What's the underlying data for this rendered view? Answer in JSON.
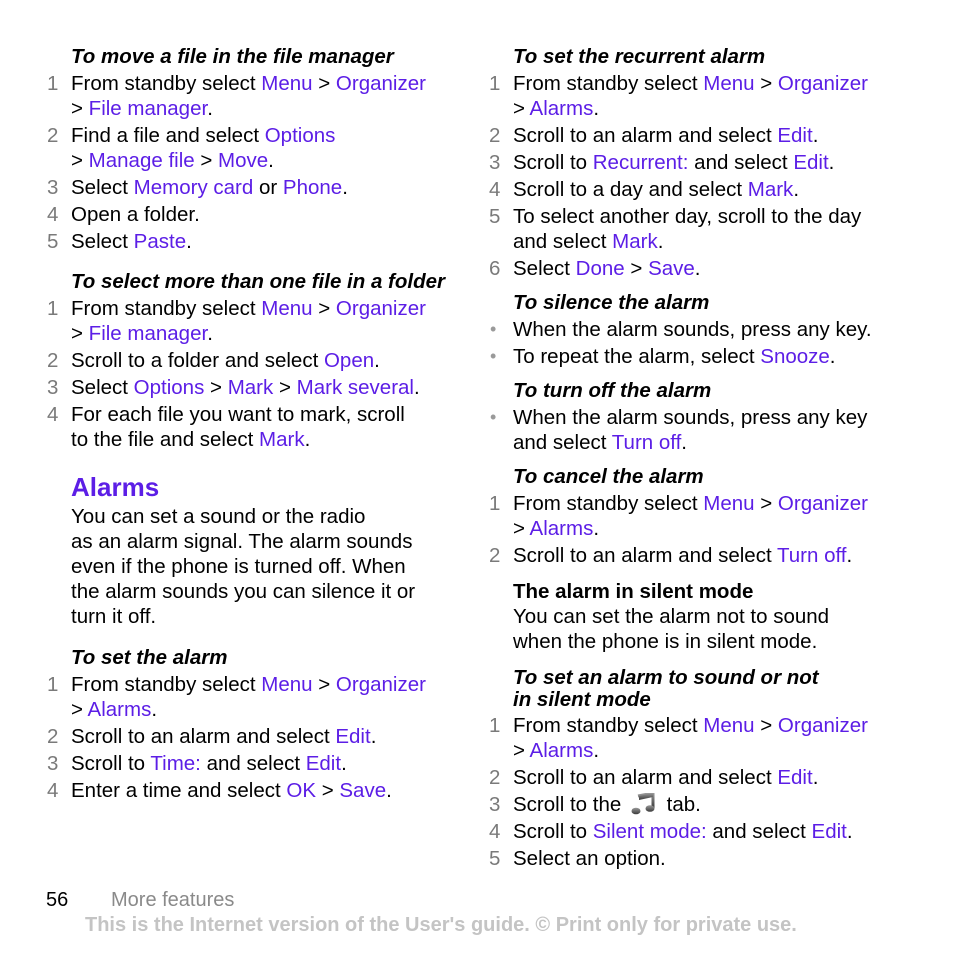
{
  "left": {
    "move_file": {
      "heading": "To move a file in the file manager",
      "steps": [
        {
          "n": "1",
          "parts": [
            {
              "t": "From standby select "
            },
            {
              "l": "Menu"
            },
            {
              "t": " > "
            },
            {
              "l": "Organizer"
            },
            {
              "br": true
            },
            {
              "t": "> "
            },
            {
              "l": "File manager"
            },
            {
              "t": "."
            }
          ]
        },
        {
          "n": "2",
          "parts": [
            {
              "t": "Find a file and select "
            },
            {
              "l": "Options"
            },
            {
              "br": true
            },
            {
              "t": "> "
            },
            {
              "l": "Manage file"
            },
            {
              "t": " > "
            },
            {
              "l": "Move"
            },
            {
              "t": "."
            }
          ]
        },
        {
          "n": "3",
          "parts": [
            {
              "t": "Select "
            },
            {
              "l": "Memory card"
            },
            {
              "t": " or "
            },
            {
              "l": "Phone"
            },
            {
              "t": "."
            }
          ]
        },
        {
          "n": "4",
          "parts": [
            {
              "t": "Open a folder."
            }
          ]
        },
        {
          "n": "5",
          "parts": [
            {
              "t": "Select "
            },
            {
              "l": "Paste"
            },
            {
              "t": "."
            }
          ]
        }
      ]
    },
    "select_more": {
      "heading": "To select more than one file in a folder",
      "steps": [
        {
          "n": "1",
          "parts": [
            {
              "t": "From standby select "
            },
            {
              "l": "Menu"
            },
            {
              "t": " > "
            },
            {
              "l": "Organizer"
            },
            {
              "br": true
            },
            {
              "t": "> "
            },
            {
              "l": "File manager"
            },
            {
              "t": "."
            }
          ]
        },
        {
          "n": "2",
          "parts": [
            {
              "t": "Scroll to a folder and select "
            },
            {
              "l": "Open"
            },
            {
              "t": "."
            }
          ]
        },
        {
          "n": "3",
          "parts": [
            {
              "t": "Select "
            },
            {
              "l": "Options"
            },
            {
              "t": " > "
            },
            {
              "l": "Mark"
            },
            {
              "t": " > "
            },
            {
              "l": "Mark several"
            },
            {
              "t": "."
            }
          ]
        },
        {
          "n": "4",
          "parts": [
            {
              "t": "For each file you want to mark, scroll"
            },
            {
              "br": true
            },
            {
              "t": "to the file and select "
            },
            {
              "l": "Mark"
            },
            {
              "t": "."
            }
          ]
        }
      ]
    },
    "alarms_title": "Alarms",
    "alarms_intro_lines": [
      "You can set a sound or the radio",
      "as an alarm signal. The alarm sounds",
      "even if the phone is turned off. When",
      "the alarm sounds you can silence it or",
      "turn it off."
    ],
    "set_alarm": {
      "heading": "To set the alarm",
      "steps": [
        {
          "n": "1",
          "parts": [
            {
              "t": "From standby select "
            },
            {
              "l": "Menu"
            },
            {
              "t": " > "
            },
            {
              "l": "Organizer"
            },
            {
              "br": true
            },
            {
              "t": "> "
            },
            {
              "l": "Alarms"
            },
            {
              "t": "."
            }
          ]
        },
        {
          "n": "2",
          "parts": [
            {
              "t": "Scroll to an alarm and select "
            },
            {
              "l": "Edit"
            },
            {
              "t": "."
            }
          ]
        },
        {
          "n": "3",
          "parts": [
            {
              "t": "Scroll to "
            },
            {
              "l": "Time:"
            },
            {
              "t": " and select "
            },
            {
              "l": "Edit"
            },
            {
              "t": "."
            }
          ]
        },
        {
          "n": "4",
          "parts": [
            {
              "t": "Enter a time and select "
            },
            {
              "l": "OK"
            },
            {
              "t": " > "
            },
            {
              "l": "Save"
            },
            {
              "t": "."
            }
          ]
        }
      ]
    }
  },
  "right": {
    "recurrent": {
      "heading": "To set the recurrent alarm",
      "steps": [
        {
          "n": "1",
          "parts": [
            {
              "t": "From standby select "
            },
            {
              "l": "Menu"
            },
            {
              "t": " > "
            },
            {
              "l": "Organizer"
            },
            {
              "br": true
            },
            {
              "t": "> "
            },
            {
              "l": "Alarms"
            },
            {
              "t": "."
            }
          ]
        },
        {
          "n": "2",
          "parts": [
            {
              "t": "Scroll to an alarm and select "
            },
            {
              "l": "Edit"
            },
            {
              "t": "."
            }
          ]
        },
        {
          "n": "3",
          "parts": [
            {
              "t": "Scroll to "
            },
            {
              "l": "Recurrent:"
            },
            {
              "t": " and select "
            },
            {
              "l": "Edit"
            },
            {
              "t": "."
            }
          ]
        },
        {
          "n": "4",
          "parts": [
            {
              "t": "Scroll to a day and select "
            },
            {
              "l": "Mark"
            },
            {
              "t": "."
            }
          ]
        },
        {
          "n": "5",
          "parts": [
            {
              "t": "To select another day, scroll to the day"
            },
            {
              "br": true
            },
            {
              "t": "and select "
            },
            {
              "l": "Mark"
            },
            {
              "t": "."
            }
          ]
        },
        {
          "n": "6",
          "parts": [
            {
              "t": "Select "
            },
            {
              "l": "Done"
            },
            {
              "t": " > "
            },
            {
              "l": "Save"
            },
            {
              "t": "."
            }
          ]
        }
      ]
    },
    "silence": {
      "heading": "To silence the alarm",
      "bullets": [
        {
          "parts": [
            {
              "t": "When the alarm sounds, press any key."
            }
          ]
        },
        {
          "parts": [
            {
              "t": "To repeat the alarm, select "
            },
            {
              "l": "Snooze"
            },
            {
              "t": "."
            }
          ]
        }
      ]
    },
    "turn_off": {
      "heading": "To turn off the alarm",
      "bullets": [
        {
          "parts": [
            {
              "t": "When the alarm sounds, press any key"
            },
            {
              "br": true
            },
            {
              "t": "and select "
            },
            {
              "l": "Turn off"
            },
            {
              "t": "."
            }
          ]
        }
      ]
    },
    "cancel": {
      "heading": "To cancel the alarm",
      "steps": [
        {
          "n": "1",
          "parts": [
            {
              "t": "From standby select "
            },
            {
              "l": "Menu"
            },
            {
              "t": " > "
            },
            {
              "l": "Organizer"
            },
            {
              "br": true
            },
            {
              "t": "> "
            },
            {
              "l": "Alarms"
            },
            {
              "t": "."
            }
          ]
        },
        {
          "n": "2",
          "parts": [
            {
              "t": "Scroll to an alarm and select "
            },
            {
              "l": "Turn off"
            },
            {
              "t": "."
            }
          ]
        }
      ]
    },
    "silent_mode_subhead": "The alarm in silent mode",
    "silent_mode_lines": [
      "You can set the alarm not to sound",
      "when the phone is in silent mode."
    ],
    "silent_set": {
      "heading_lines": [
        "To set an alarm to sound or not",
        "in silent mode"
      ],
      "steps": [
        {
          "n": "1",
          "parts": [
            {
              "t": "From standby select "
            },
            {
              "l": "Menu"
            },
            {
              "t": " > "
            },
            {
              "l": "Organizer"
            },
            {
              "br": true
            },
            {
              "t": "> "
            },
            {
              "l": "Alarms"
            },
            {
              "t": "."
            }
          ]
        },
        {
          "n": "2",
          "parts": [
            {
              "t": "Scroll to an alarm and select "
            },
            {
              "l": "Edit"
            },
            {
              "t": "."
            }
          ]
        },
        {
          "n": "3",
          "parts": [
            {
              "t": "Scroll to the "
            },
            {
              "icon": "music-note-icon"
            },
            {
              "t": " tab."
            }
          ]
        },
        {
          "n": "4",
          "parts": [
            {
              "t": "Scroll to "
            },
            {
              "l": "Silent mode:"
            },
            {
              "t": " and select "
            },
            {
              "l": "Edit"
            },
            {
              "t": "."
            }
          ]
        },
        {
          "n": "5",
          "parts": [
            {
              "t": "Select an option."
            }
          ]
        }
      ]
    }
  },
  "footer": {
    "page_number": "56",
    "section": "More features",
    "notice": "This is the Internet version of the User's guide. © Print only for private use."
  },
  "colors": {
    "link": "#5c1ee6",
    "step_number": "#7a7a7a",
    "footer_notice": "#c4c4c4"
  }
}
